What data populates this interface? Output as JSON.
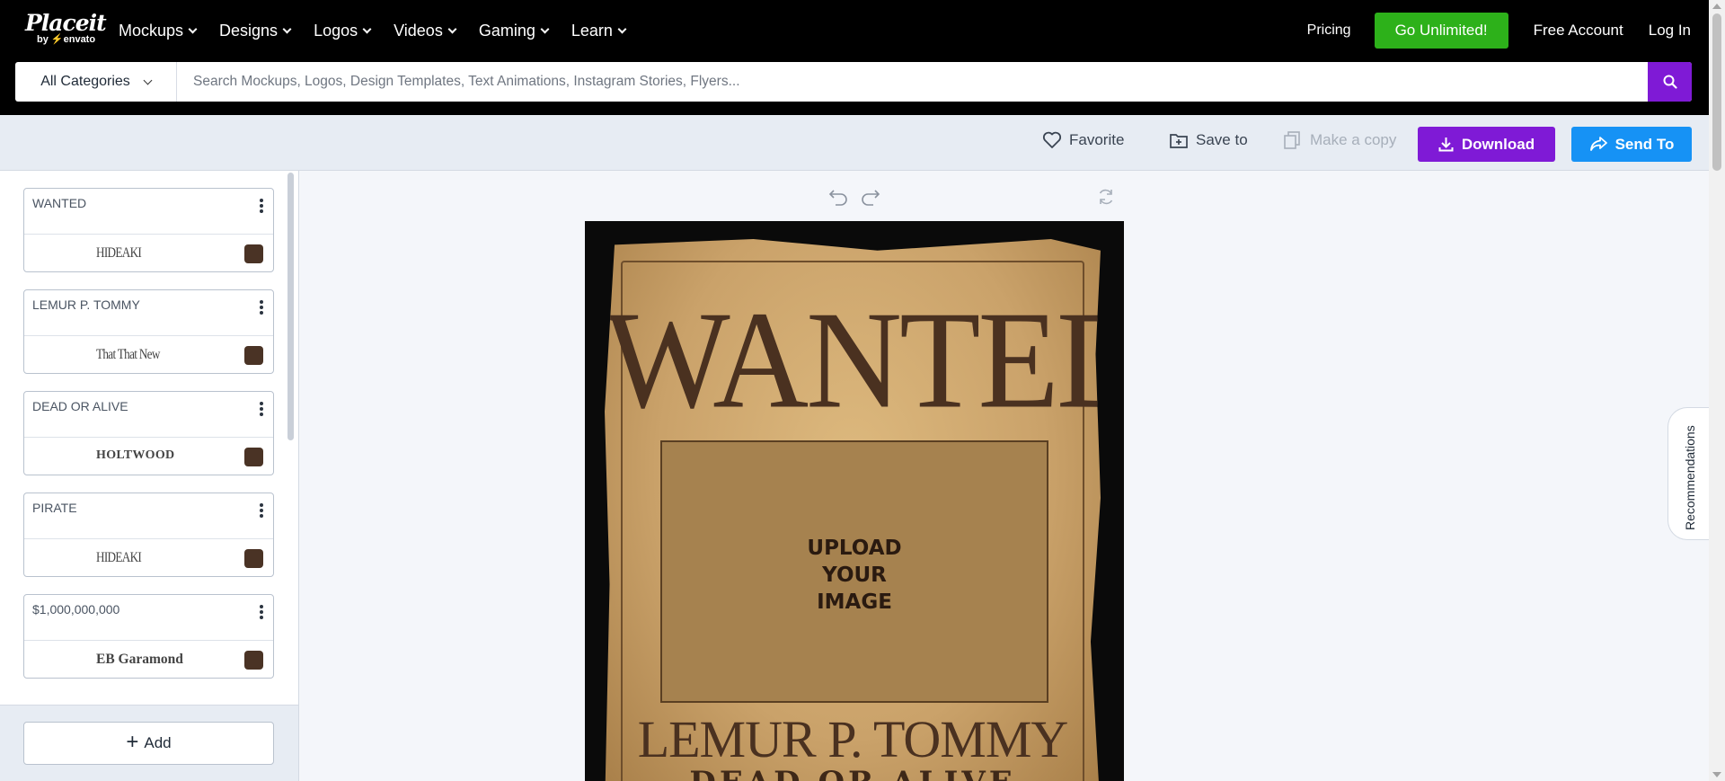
{
  "brand": {
    "name": "Placeit",
    "by": "by",
    "envato": "envato"
  },
  "nav": {
    "items": [
      "Mockups",
      "Designs",
      "Logos",
      "Videos",
      "Gaming",
      "Learn"
    ],
    "pricing": "Pricing",
    "unlimited": "Go Unlimited!",
    "free_account": "Free Account",
    "login": "Log In"
  },
  "search": {
    "category": "All Categories",
    "placeholder": "Search Mockups, Logos, Design Templates, Text Animations, Instagram Stories, Flyers..."
  },
  "toolbar": {
    "favorite": "Favorite",
    "save_to": "Save to",
    "make_copy": "Make a copy",
    "download": "Download",
    "send_to": "Send To"
  },
  "layers": [
    {
      "text": "WANTED",
      "font": "HIDEAKI",
      "color": "#4a3325"
    },
    {
      "text": "LEMUR P. TOMMY",
      "font": "That That New",
      "color": "#4a3325"
    },
    {
      "text": "DEAD OR ALIVE",
      "font": "HOLTWOOD",
      "color": "#4a3325"
    },
    {
      "text": "PIRATE",
      "font": "HIDEAKI",
      "color": "#4a3325"
    },
    {
      "text": "$1,000,000,000",
      "font": "EB Garamond",
      "color": "#4a3325"
    }
  ],
  "add_label": "Add",
  "poster": {
    "title": "WANTED",
    "upload_line1": "UPLOAD",
    "upload_line2": "YOUR",
    "upload_line3": "IMAGE",
    "name": "LEMUR P. TOMMY",
    "subtitle": "DEAD OR ALIVE"
  },
  "recommendations": "Recommendations",
  "colors": {
    "download": "#7f1ad6",
    "send_to": "#1692f5",
    "unlimited": "#2db11a"
  }
}
